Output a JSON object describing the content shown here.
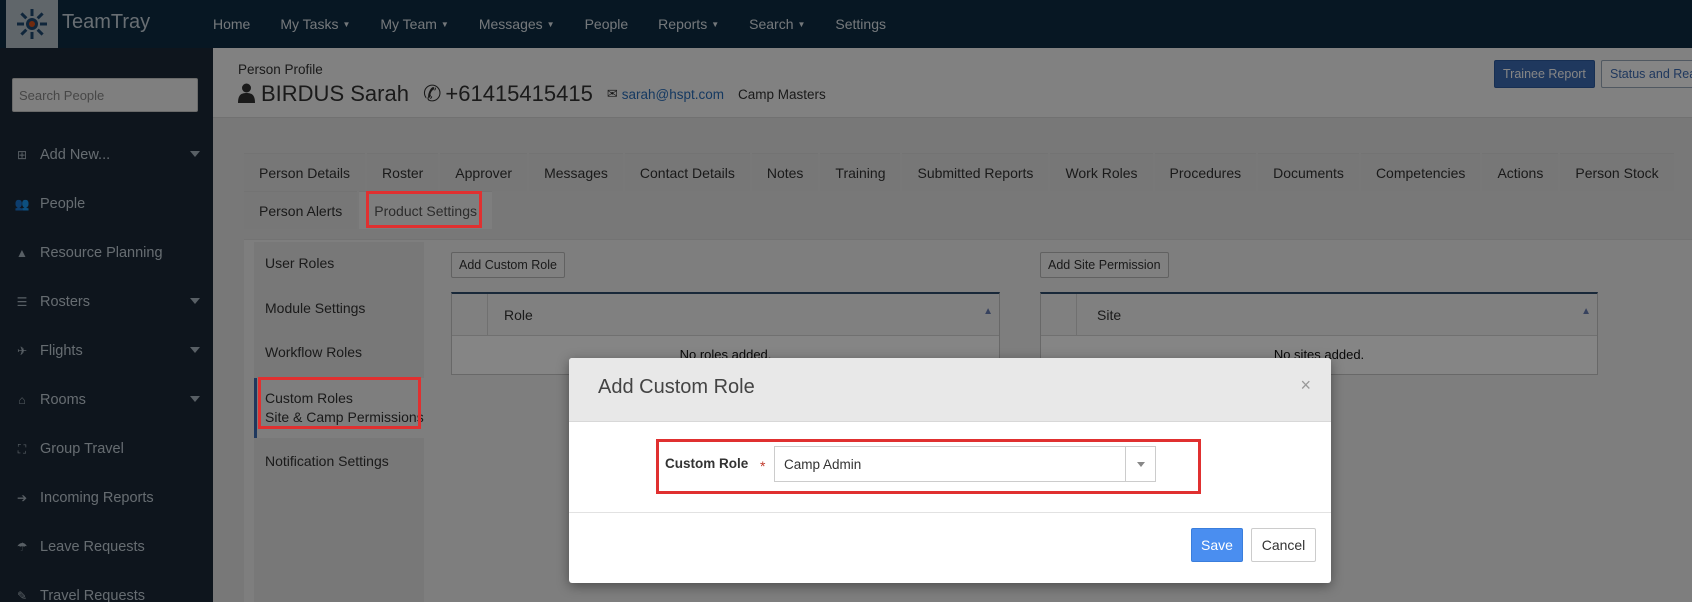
{
  "app": {
    "name": "TeamTray"
  },
  "topnav": {
    "items": [
      {
        "label": "Home",
        "dropdown": false
      },
      {
        "label": "My Tasks",
        "dropdown": true
      },
      {
        "label": "My Team",
        "dropdown": true
      },
      {
        "label": "Messages",
        "dropdown": true
      },
      {
        "label": "People",
        "dropdown": false
      },
      {
        "label": "Reports",
        "dropdown": true
      },
      {
        "label": "Search",
        "dropdown": true
      },
      {
        "label": "Settings",
        "dropdown": false
      }
    ]
  },
  "sidebar": {
    "search_placeholder": "Search People",
    "items": [
      {
        "label": "Add New...",
        "icon": "plus-square-icon",
        "dropdown": true
      },
      {
        "label": "People",
        "icon": "users-icon",
        "dropdown": false
      },
      {
        "label": "Resource Planning",
        "icon": "road-icon",
        "dropdown": false
      },
      {
        "label": "Rosters",
        "icon": "tasks-icon",
        "dropdown": true
      },
      {
        "label": "Flights",
        "icon": "plane-icon",
        "dropdown": true
      },
      {
        "label": "Rooms",
        "icon": "home-icon",
        "dropdown": true
      },
      {
        "label": "Group Travel",
        "icon": "group-icon",
        "dropdown": false
      },
      {
        "label": "Incoming Reports",
        "icon": "sign-in-icon",
        "dropdown": false
      },
      {
        "label": "Leave Requests",
        "icon": "umbrella-icon",
        "dropdown": false
      },
      {
        "label": "Travel Requests",
        "icon": "travel-icon",
        "dropdown": false
      }
    ]
  },
  "header": {
    "section_label": "Person Profile",
    "person_name": "BIRDUS Sarah",
    "phone": "+61415415415",
    "email": "sarah@hspt.com",
    "organization": "Camp Masters",
    "buttons": {
      "trainee_report": "Trainee Report",
      "status_report": "Status and Rea"
    }
  },
  "tabs": {
    "row1": [
      "Person Details",
      "Roster",
      "Approver",
      "Messages",
      "Contact Details",
      "Notes",
      "Training",
      "Submitted Reports",
      "Work Roles",
      "Procedures",
      "Documents",
      "Competencies",
      "Actions",
      "Person Stock"
    ],
    "row2": [
      "Person Alerts",
      "Product Settings"
    ],
    "active": "Product Settings"
  },
  "settings_nav": {
    "items": [
      "User Roles",
      "Module Settings",
      "Workflow Roles",
      "Custom Roles",
      "Site & Camp Permissions",
      "Notification Settings"
    ],
    "active": "Custom Roles"
  },
  "roles_panel": {
    "add_button": "Add Custom Role",
    "column": "Role",
    "empty_text": "No roles added."
  },
  "sites_panel": {
    "add_button": "Add Site Permission",
    "column": "Site",
    "empty_text": "No sites added."
  },
  "modal": {
    "title": "Add Custom Role",
    "close_glyph": "×",
    "field_label": "Custom Role",
    "required_mark": "*",
    "selected_value": "Camp Admin",
    "save_label": "Save",
    "cancel_label": "Cancel"
  },
  "colors": {
    "topnav_bg": "#0e2d44",
    "sidebar_bg": "#1c2a38",
    "primary_button": "#4a8ef0",
    "highlight_red": "#e03030"
  }
}
